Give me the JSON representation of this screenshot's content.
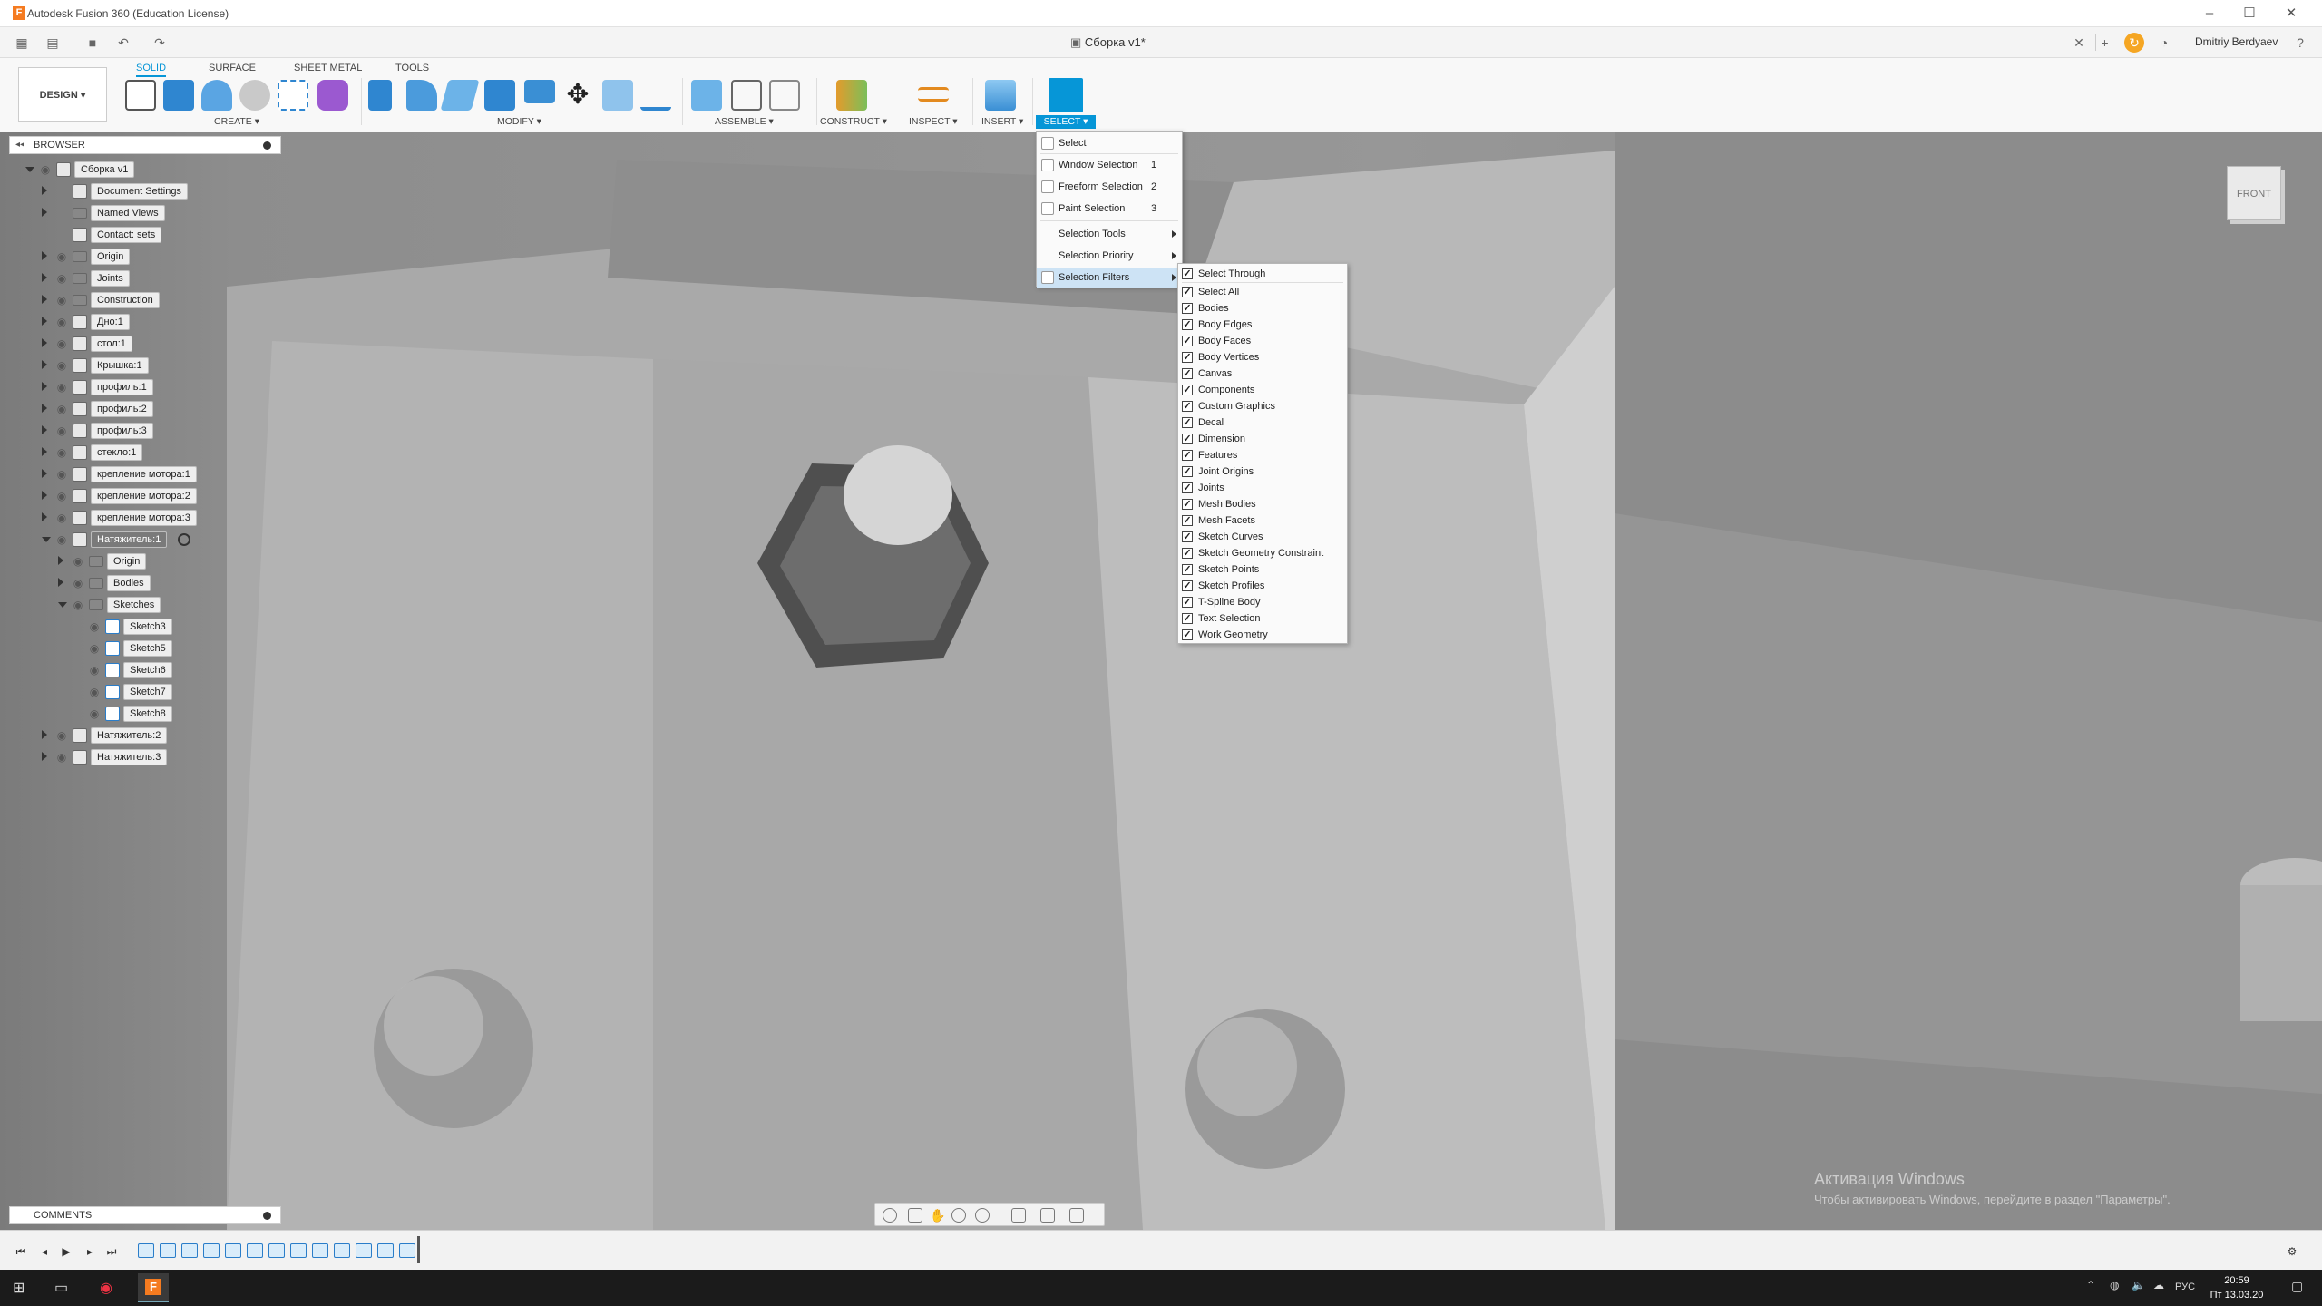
{
  "window": {
    "title": "Autodesk Fusion 360 (Education License)",
    "document_tab": "Сборка v1*",
    "user": "Dmitriy Berdyaev"
  },
  "ribbon": {
    "workspace": "DESIGN",
    "tabs": [
      "SOLID",
      "SURFACE",
      "SHEET METAL",
      "TOOLS"
    ],
    "active_tab": "SOLID",
    "groups": {
      "create": "CREATE",
      "modify": "MODIFY",
      "assemble": "ASSEMBLE",
      "construct": "CONSTRUCT",
      "inspect": "INSPECT",
      "insert": "INSERT",
      "select": "SELECT"
    }
  },
  "browser": {
    "title": "BROWSER",
    "items": [
      {
        "label": "Сборка v1",
        "kind": "doc"
      },
      {
        "label": "Document Settings",
        "kind": "gear"
      },
      {
        "label": "Named Views",
        "kind": "folder"
      },
      {
        "label": "Contact: sets",
        "kind": "contact"
      },
      {
        "label": "Origin",
        "kind": "folder"
      },
      {
        "label": "Joints",
        "kind": "folder"
      },
      {
        "label": "Construction",
        "kind": "folder"
      },
      {
        "label": "Дно:1",
        "kind": "comp"
      },
      {
        "label": "стол:1",
        "kind": "comp"
      },
      {
        "label": "Крышка:1",
        "kind": "comp"
      },
      {
        "label": "профиль:1",
        "kind": "comp"
      },
      {
        "label": "профиль:2",
        "kind": "comp"
      },
      {
        "label": "профиль:3",
        "kind": "comp"
      },
      {
        "label": "стекло:1",
        "kind": "comp"
      },
      {
        "label": "крепление мотора:1",
        "kind": "comp"
      },
      {
        "label": "крепление мотора:2",
        "kind": "comp"
      },
      {
        "label": "крепление мотора:3",
        "kind": "comp"
      },
      {
        "label": "Натяжитель:1",
        "kind": "comp-active"
      },
      {
        "label": "Origin",
        "kind": "folder"
      },
      {
        "label": "Bodies",
        "kind": "folder"
      },
      {
        "label": "Sketches",
        "kind": "folder"
      },
      {
        "label": "Sketch3",
        "kind": "sketch"
      },
      {
        "label": "Sketch5",
        "kind": "sketch"
      },
      {
        "label": "Sketch6",
        "kind": "sketch"
      },
      {
        "label": "Sketch7",
        "kind": "sketch"
      },
      {
        "label": "Sketch8",
        "kind": "sketch"
      },
      {
        "label": "Натяжитель:2",
        "kind": "comp"
      },
      {
        "label": "Натяжитель:3",
        "kind": "comp"
      }
    ]
  },
  "comments": {
    "title": "COMMENTS"
  },
  "viewcube": {
    "face": "FRONT"
  },
  "select_menu": {
    "items": [
      {
        "label": "Select",
        "shortcut": ""
      },
      {
        "label": "Window Selection",
        "shortcut": "1"
      },
      {
        "label": "Freeform Selection",
        "shortcut": "2"
      },
      {
        "label": "Paint Selection",
        "shortcut": "3"
      },
      {
        "label": "Selection Tools",
        "shortcut": ""
      },
      {
        "label": "Selection Priority",
        "shortcut": ""
      },
      {
        "label": "Selection Filters",
        "shortcut": ""
      }
    ]
  },
  "selection_filters": [
    {
      "label": "Select Through",
      "checked": true
    },
    {
      "label": "Select All",
      "checked": true
    },
    {
      "label": "Bodies",
      "checked": true
    },
    {
      "label": "Body Edges",
      "checked": true
    },
    {
      "label": "Body Faces",
      "checked": true
    },
    {
      "label": "Body Vertices",
      "checked": true
    },
    {
      "label": "Canvas",
      "checked": true
    },
    {
      "label": "Components",
      "checked": true
    },
    {
      "label": "Custom Graphics",
      "checked": true
    },
    {
      "label": "Decal",
      "checked": true
    },
    {
      "label": "Dimension",
      "checked": true
    },
    {
      "label": "Features",
      "checked": true
    },
    {
      "label": "Joint Origins",
      "checked": true
    },
    {
      "label": "Joints",
      "checked": true
    },
    {
      "label": "Mesh Bodies",
      "checked": true
    },
    {
      "label": "Mesh Facets",
      "checked": true
    },
    {
      "label": "Sketch Curves",
      "checked": true
    },
    {
      "label": "Sketch Geometry Constraint",
      "checked": true
    },
    {
      "label": "Sketch Points",
      "checked": true
    },
    {
      "label": "Sketch Profiles",
      "checked": true
    },
    {
      "label": "T-Spline Body",
      "checked": true
    },
    {
      "label": "Text Selection",
      "checked": true
    },
    {
      "label": "Work Geometry",
      "checked": true
    }
  ],
  "watermark": {
    "line1": "Активация Windows",
    "line2": "Чтобы активировать Windows, перейдите в раздел \"Параметры\"."
  },
  "taskbar": {
    "lang": "РУС",
    "time": "20:59",
    "date": "Пт 13.03.20"
  },
  "colors": {
    "accent": "#0696d7",
    "fusion_orange": "#f57b20"
  }
}
